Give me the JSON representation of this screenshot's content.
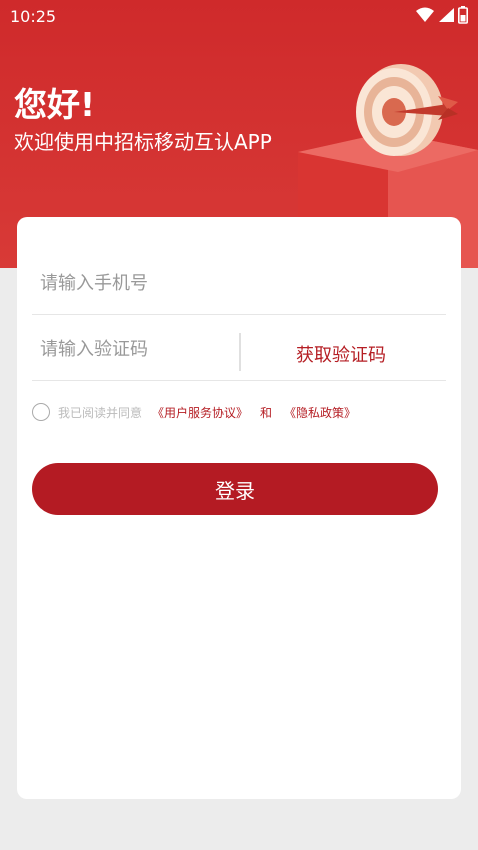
{
  "status_bar": {
    "time": "10:25",
    "icons": [
      "wifi-icon",
      "signal-icon",
      "battery-icon"
    ]
  },
  "header": {
    "greeting": "您好!",
    "welcome": "欢迎使用中招标移动互认APP"
  },
  "form": {
    "phone_placeholder": "请输入手机号",
    "code_placeholder": "请输入验证码",
    "get_code_label": "获取验证码",
    "agree_prefix": "我已阅读并同意",
    "user_agreement": "《用户服务协议》",
    "and": "和",
    "privacy_policy": "《隐私政策》",
    "login_label": "登录"
  },
  "colors": {
    "brand_red": "#b41b23",
    "header_red": "#cf2a2b",
    "background": "#ececec"
  }
}
